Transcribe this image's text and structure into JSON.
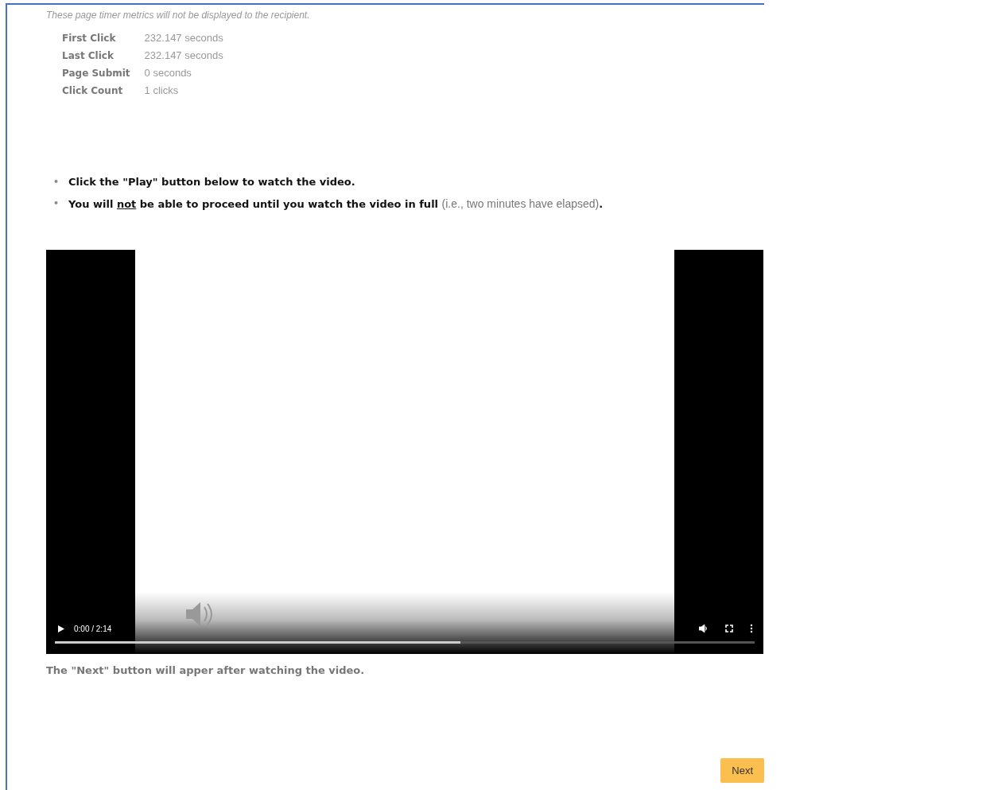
{
  "notice": "These page timer metrics will not be displayed to the recipient.",
  "metrics": [
    {
      "label": "First Click",
      "value": "232.147 seconds"
    },
    {
      "label": "Last Click",
      "value": "232.147 seconds"
    },
    {
      "label": "Page Submit",
      "value": "0 seconds"
    },
    {
      "label": "Click Count",
      "value": "1 clicks"
    }
  ],
  "instructions": [
    {
      "marker": "•",
      "parts": [
        {
          "text": "Click the \"Play\" button below to watch the video.",
          "underline": false
        }
      ]
    },
    {
      "marker": "•",
      "parts": [
        {
          "text": "You will",
          "underline": false
        },
        {
          "text": "not",
          "underline": true
        },
        {
          "text": "be able to proceed until you watch the video in full",
          "underline": false
        }
      ]
    }
  ],
  "instruction_note": "(i.e., two minutes have elapsed)",
  "instruction_end": ".",
  "video": {
    "time": "0:00 / 2:14",
    "progress": {
      "level": 0.58
    }
  },
  "caption": "The \"Next\" button will apper after watching the video.",
  "next_button": "Next"
}
